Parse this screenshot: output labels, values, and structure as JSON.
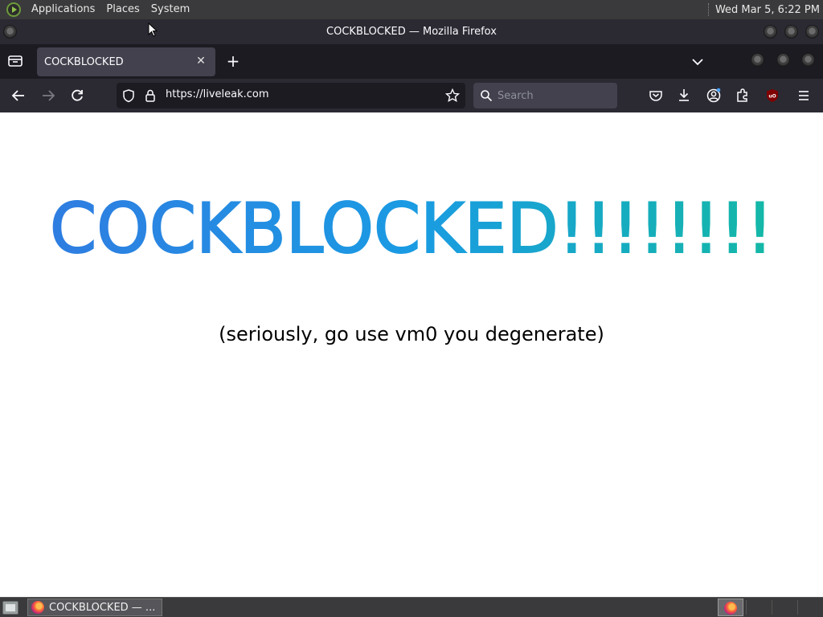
{
  "top_panel": {
    "menu": [
      "Applications",
      "Places",
      "System"
    ],
    "clock": "Wed Mar  5,  6:22 PM"
  },
  "window": {
    "title": "COCKBLOCKED — Mozilla Firefox"
  },
  "tabs": [
    {
      "label": "COCKBLOCKED",
      "active": true
    }
  ],
  "navbar": {
    "url": "https://liveleak.com",
    "search_placeholder": "Search"
  },
  "page": {
    "headline": "COCKBLOCKED!!!!!!!!",
    "headline_gradient": [
      "#2f7de1",
      "#1a9be3",
      "#14b8a6"
    ],
    "subtext": "(seriously, go use vm0 you degenerate)"
  },
  "taskbar": {
    "task_label": "COCKBLOCKED — ..."
  },
  "colors": {
    "panel": "#3a3a3c",
    "firefox_chrome": "#2b2a33",
    "tabstrip": "#1c1b22",
    "active_tab": "#42414d",
    "ublock_red": "#800000"
  }
}
